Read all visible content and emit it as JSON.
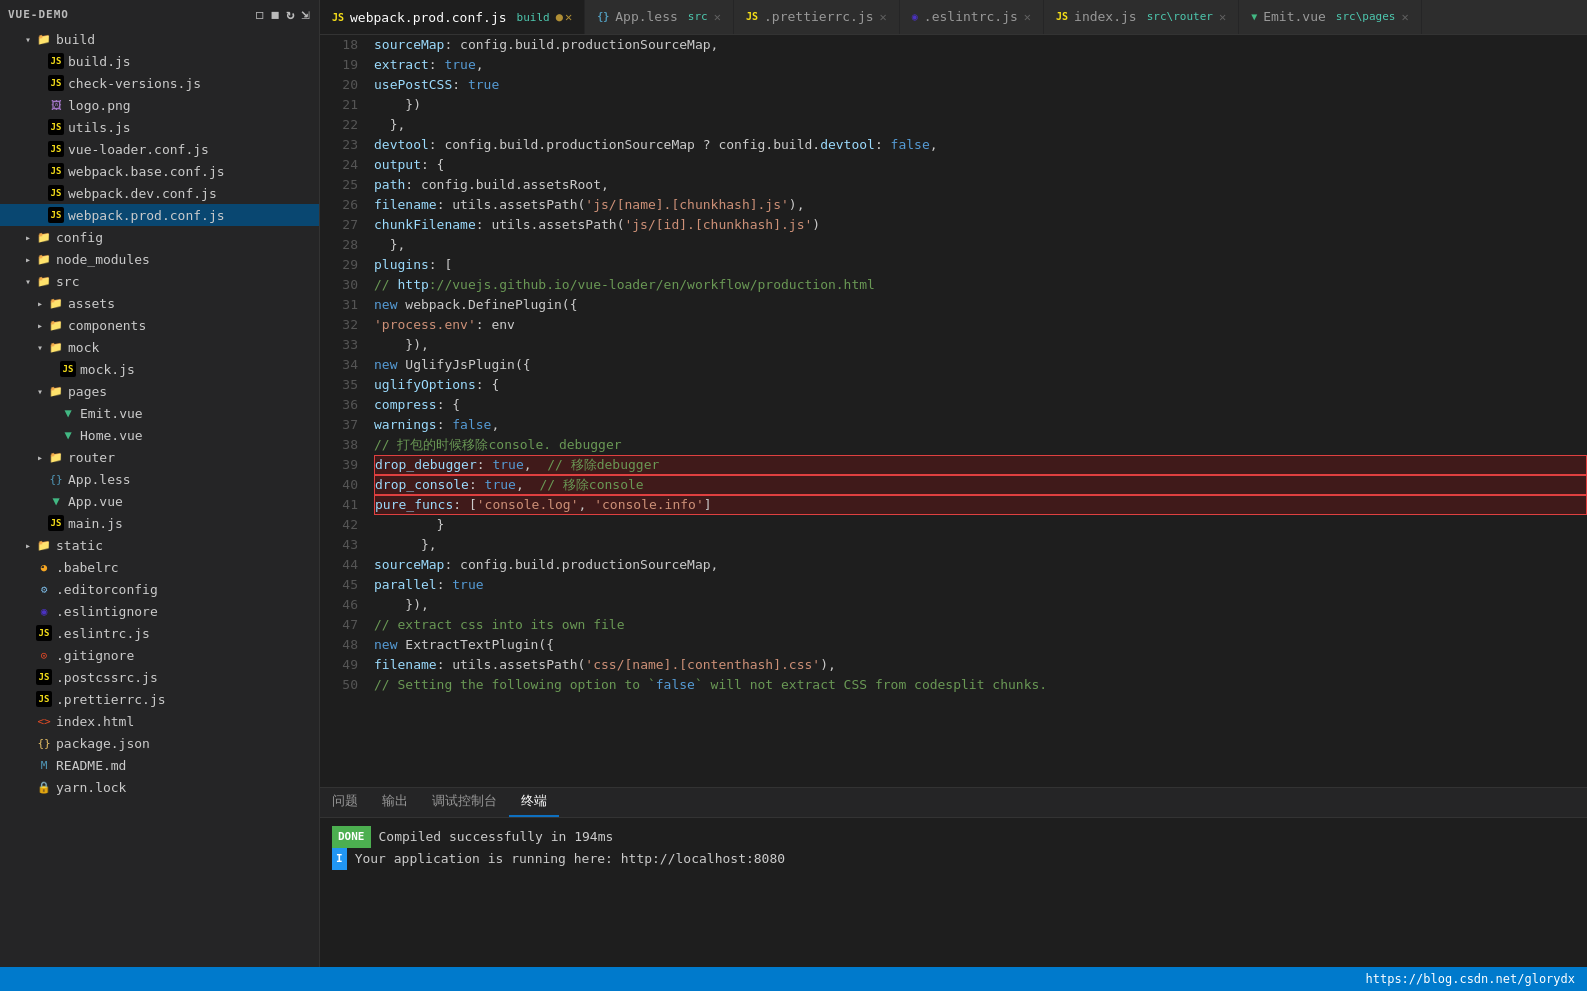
{
  "sidebar": {
    "title": "VUE-DEMO",
    "items": [
      {
        "id": "build-folder",
        "label": "build",
        "type": "folder",
        "expanded": true,
        "indent": 1,
        "icon": "folder"
      },
      {
        "id": "build.js",
        "label": "build.js",
        "type": "js",
        "indent": 2,
        "icon": "js"
      },
      {
        "id": "check-versions.js",
        "label": "check-versions.js",
        "type": "js",
        "indent": 2,
        "icon": "js"
      },
      {
        "id": "logo.png",
        "label": "logo.png",
        "type": "png",
        "indent": 2,
        "icon": "png"
      },
      {
        "id": "utils.js",
        "label": "utils.js",
        "type": "js",
        "indent": 2,
        "icon": "js"
      },
      {
        "id": "vue-loader.conf.js",
        "label": "vue-loader.conf.js",
        "type": "js",
        "indent": 2,
        "icon": "js"
      },
      {
        "id": "webpack.base.conf.js",
        "label": "webpack.base.conf.js",
        "type": "js",
        "indent": 2,
        "icon": "js"
      },
      {
        "id": "webpack.dev.conf.js",
        "label": "webpack.dev.conf.js",
        "type": "js",
        "indent": 2,
        "icon": "js"
      },
      {
        "id": "webpack.prod.conf.js",
        "label": "webpack.prod.conf.js",
        "type": "js",
        "indent": 2,
        "icon": "js",
        "active": true
      },
      {
        "id": "config-folder",
        "label": "config",
        "type": "folder",
        "expanded": false,
        "indent": 1,
        "icon": "folder"
      },
      {
        "id": "node_modules-folder",
        "label": "node_modules",
        "type": "folder",
        "expanded": false,
        "indent": 1,
        "icon": "folder"
      },
      {
        "id": "src-folder",
        "label": "src",
        "type": "folder",
        "expanded": true,
        "indent": 1,
        "icon": "folder"
      },
      {
        "id": "assets-folder",
        "label": "assets",
        "type": "folder",
        "expanded": false,
        "indent": 2,
        "icon": "folder"
      },
      {
        "id": "components-folder",
        "label": "components",
        "type": "folder",
        "expanded": false,
        "indent": 2,
        "icon": "folder"
      },
      {
        "id": "mock-folder",
        "label": "mock",
        "type": "folder",
        "expanded": true,
        "indent": 2,
        "icon": "folder"
      },
      {
        "id": "mock.js",
        "label": "mock.js",
        "type": "js",
        "indent": 3,
        "icon": "js"
      },
      {
        "id": "pages-folder",
        "label": "pages",
        "type": "folder",
        "expanded": true,
        "indent": 2,
        "icon": "folder"
      },
      {
        "id": "Emit.vue",
        "label": "Emit.vue",
        "type": "vue",
        "indent": 3,
        "icon": "vue"
      },
      {
        "id": "Home.vue",
        "label": "Home.vue",
        "type": "vue",
        "indent": 3,
        "icon": "vue"
      },
      {
        "id": "router-folder",
        "label": "router",
        "type": "folder",
        "expanded": false,
        "indent": 2,
        "icon": "folder"
      },
      {
        "id": "App.less",
        "label": "App.less",
        "type": "css",
        "indent": 2,
        "icon": "css"
      },
      {
        "id": "App.vue",
        "label": "App.vue",
        "type": "vue",
        "indent": 2,
        "icon": "vue"
      },
      {
        "id": "main.js",
        "label": "main.js",
        "type": "js",
        "indent": 2,
        "icon": "js"
      },
      {
        "id": "static-folder",
        "label": "static",
        "type": "folder",
        "expanded": false,
        "indent": 1,
        "icon": "folder"
      },
      {
        "id": ".babelrc",
        "label": ".babelrc",
        "type": "babel",
        "indent": 1,
        "icon": "babel"
      },
      {
        "id": ".editorconfig",
        "label": ".editorconfig",
        "type": "editor",
        "indent": 1,
        "icon": "editor"
      },
      {
        "id": ".eslintignore",
        "label": ".eslintignore",
        "type": "eslint",
        "indent": 1,
        "icon": "eslint"
      },
      {
        "id": ".eslintrc.js",
        "label": ".eslintrc.js",
        "type": "js",
        "indent": 1,
        "icon": "js"
      },
      {
        "id": ".gitignore",
        "label": ".gitignore",
        "type": "git",
        "indent": 1,
        "icon": "git"
      },
      {
        "id": ".postcssrc.js",
        "label": ".postcssrc.js",
        "type": "js",
        "indent": 1,
        "icon": "js"
      },
      {
        "id": ".prettierrc.js",
        "label": ".prettierrc.js",
        "type": "js",
        "indent": 1,
        "icon": "js"
      },
      {
        "id": "index.html",
        "label": "index.html",
        "type": "html",
        "indent": 1,
        "icon": "html"
      },
      {
        "id": "package.json",
        "label": "package.json",
        "type": "json",
        "indent": 1,
        "icon": "json"
      },
      {
        "id": "README.md",
        "label": "README.md",
        "type": "md",
        "indent": 1,
        "icon": "md"
      },
      {
        "id": "yarn.lock",
        "label": "yarn.lock",
        "type": "lock",
        "indent": 1,
        "icon": "lock"
      }
    ]
  },
  "tabs": [
    {
      "id": "webpack.prod.conf.js",
      "label": "webpack.prod.conf.js",
      "tag": "build",
      "active": true,
      "modified": true,
      "icon": "js"
    },
    {
      "id": "App.less",
      "label": "App.less",
      "tag": "src",
      "active": false,
      "icon": "css"
    },
    {
      "id": ".prettierrc.js",
      "label": ".prettierrc.js",
      "tag": "",
      "active": false,
      "icon": "js"
    },
    {
      "id": ".eslintrc.js",
      "label": ".eslintrc.js",
      "tag": "",
      "active": false,
      "icon": "eslint"
    },
    {
      "id": "index.js",
      "label": "index.js",
      "tag": "src\\router",
      "active": false,
      "icon": "js"
    },
    {
      "id": "Emit.vue",
      "label": "Emit.vue",
      "tag": "src\\pages",
      "active": false,
      "icon": "vue"
    }
  ],
  "code": {
    "lines": [
      {
        "num": 18,
        "text": "      sourceMap: config.build.productionSourceMap,",
        "highlight": false
      },
      {
        "num": 19,
        "text": "      extract: true,",
        "highlight": false
      },
      {
        "num": 20,
        "text": "      usePostCSS: true",
        "highlight": false
      },
      {
        "num": 21,
        "text": "    })",
        "highlight": false
      },
      {
        "num": 22,
        "text": "  },",
        "highlight": false
      },
      {
        "num": 23,
        "text": "  devtool: config.build.productionSourceMap ? config.build.devtool : false,",
        "highlight": false
      },
      {
        "num": 24,
        "text": "  output: {",
        "highlight": false
      },
      {
        "num": 25,
        "text": "    path: config.build.assetsRoot,",
        "highlight": false
      },
      {
        "num": 26,
        "text": "    filename: utils.assetsPath('js/[name].[chunkhash].js'),",
        "highlight": false
      },
      {
        "num": 27,
        "text": "    chunkFilename: utils.assetsPath('js/[id].[chunkhash].js')",
        "highlight": false
      },
      {
        "num": 28,
        "text": "  },",
        "highlight": false
      },
      {
        "num": 29,
        "text": "  plugins: [",
        "highlight": false
      },
      {
        "num": 30,
        "text": "    // http://vuejs.github.io/vue-loader/en/workflow/production.html",
        "highlight": false
      },
      {
        "num": 31,
        "text": "    new webpack.DefinePlugin({",
        "highlight": false
      },
      {
        "num": 32,
        "text": "      'process.env': env",
        "highlight": false
      },
      {
        "num": 33,
        "text": "    }),",
        "highlight": false
      },
      {
        "num": 34,
        "text": "    new UglifyJsPlugin({",
        "highlight": false
      },
      {
        "num": 35,
        "text": "      uglifyOptions: {",
        "highlight": false
      },
      {
        "num": 36,
        "text": "        compress: {",
        "highlight": false
      },
      {
        "num": 37,
        "text": "          warnings: false,",
        "highlight": false
      },
      {
        "num": 38,
        "text": "          // 打包的时候移除console. debugger",
        "highlight": false
      },
      {
        "num": 39,
        "text": "          drop_debugger: true,  // 移除debugger",
        "highlight": true
      },
      {
        "num": 40,
        "text": "          drop_console: true,  // 移除console",
        "highlight": true
      },
      {
        "num": 41,
        "text": "          pure_funcs: ['console.log', 'console.info']",
        "highlight": true
      },
      {
        "num": 42,
        "text": "        }",
        "highlight": false
      },
      {
        "num": 43,
        "text": "      },",
        "highlight": false
      },
      {
        "num": 44,
        "text": "      sourceMap: config.build.productionSourceMap,",
        "highlight": false
      },
      {
        "num": 45,
        "text": "      parallel: true",
        "highlight": false
      },
      {
        "num": 46,
        "text": "    }),",
        "highlight": false
      },
      {
        "num": 47,
        "text": "    // extract css into its own file",
        "highlight": false
      },
      {
        "num": 48,
        "text": "    new ExtractTextPlugin({",
        "highlight": false
      },
      {
        "num": 49,
        "text": "      filename: utils.assetsPath('css/[name].[contenthash].css'),",
        "highlight": false
      },
      {
        "num": 50,
        "text": "      // Setting the following option to `false` will not extract CSS from codesplit chunks.",
        "highlight": false
      }
    ]
  },
  "terminal": {
    "tabs": [
      "问题",
      "输出",
      "调试控制台",
      "终端"
    ],
    "active_tab": "终端",
    "lines": [
      {
        "badge": "DONE",
        "badge_type": "done",
        "text": "Compiled successfully in 194ms"
      },
      {
        "badge": "I",
        "badge_type": "info",
        "text": "Your application is running here: http://localhost:8080"
      }
    ]
  },
  "status_bar": {
    "url": "https://blog.csdn.net/glorydx"
  }
}
